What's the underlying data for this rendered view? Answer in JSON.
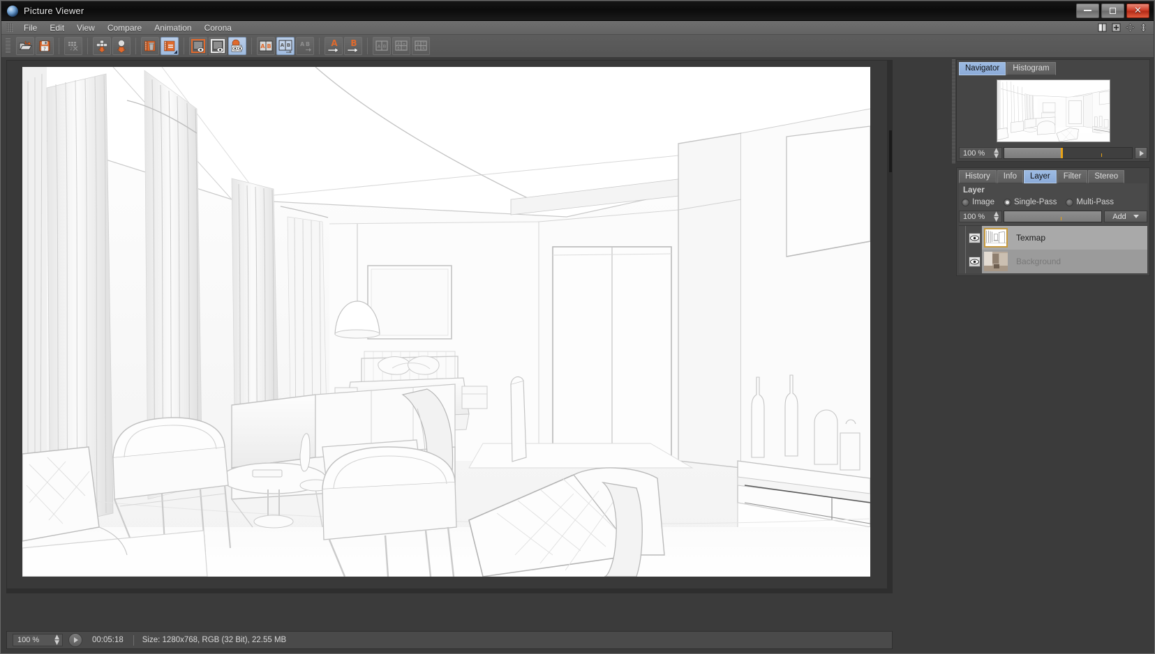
{
  "window": {
    "title": "Picture Viewer",
    "logo_icon": "cinema4d-sphere-icon",
    "minimize_label": "–",
    "maximize_label": "□",
    "close_label": "✕"
  },
  "menubar": {
    "grip_icon": "drag-grip-icon",
    "items": [
      {
        "label": "File"
      },
      {
        "label": "Edit"
      },
      {
        "label": "View"
      },
      {
        "label": "Compare"
      },
      {
        "label": "Animation"
      },
      {
        "label": "Corona"
      }
    ],
    "right_icons": [
      {
        "name": "split-layout-icon"
      },
      {
        "name": "add-panel-icon"
      },
      {
        "name": "move-panel-icon"
      },
      {
        "name": "resize-panel-icon"
      }
    ]
  },
  "toolbar": {
    "grip_icon": "drag-grip-icon",
    "groups": [
      {
        "buttons": [
          {
            "name": "open-file-button",
            "icon": "open-folder-icon",
            "active": false
          },
          {
            "name": "save-file-button",
            "icon": "save-disk-question-icon",
            "active": false
          }
        ]
      },
      {
        "buttons": [
          {
            "name": "filmstrip-button",
            "icon": "filmstrip-grid-icon",
            "active": false
          }
        ]
      },
      {
        "buttons": [
          {
            "name": "store-all-button",
            "icon": "store-all-frames-icon",
            "active": false
          },
          {
            "name": "store-frame-button",
            "icon": "store-single-frame-icon",
            "active": false
          }
        ]
      },
      {
        "buttons": [
          {
            "name": "delete-frame-button",
            "icon": "delete-frame-trash-icon",
            "active": false
          },
          {
            "name": "delete-all-button",
            "icon": "delete-all-frames-icon",
            "active": true
          }
        ]
      },
      {
        "buttons": [
          {
            "name": "view-a-button",
            "icon": "single-view-a-icon",
            "active": false
          },
          {
            "name": "view-b-button",
            "icon": "single-view-b-icon",
            "active": false
          },
          {
            "name": "view-ab-button",
            "icon": "blend-view-icon",
            "active": true
          }
        ]
      },
      {
        "buttons": [
          {
            "name": "compare-ab-button",
            "icon": "compare-ab-icon",
            "active": false
          },
          {
            "name": "compare-ab-swap-button",
            "icon": "compare-ab-swap-icon",
            "active": true
          },
          {
            "name": "compare-ab-diff-button",
            "icon": "compare-ab-diff-icon",
            "active": false
          }
        ]
      },
      {
        "buttons": [
          {
            "name": "set-a-button",
            "icon": "set-a-arrow-icon",
            "active": false
          },
          {
            "name": "set-b-button",
            "icon": "set-b-arrow-icon",
            "active": false
          }
        ]
      },
      {
        "buttons": [
          {
            "name": "ab-side-by-side-button",
            "icon": "ab-side-by-side-icon",
            "active": false
          },
          {
            "name": "ab-quad-button",
            "icon": "ab-quad-icon",
            "active": false
          },
          {
            "name": "ab-stack-button",
            "icon": "ab-stack-icon",
            "active": false
          }
        ]
      }
    ]
  },
  "navigator": {
    "tabs": [
      {
        "label": "Navigator",
        "active": true
      },
      {
        "label": "Histogram",
        "active": false
      }
    ],
    "zoom_value": "100 %",
    "play_icon": "play-triangle-icon",
    "spinner_icon": "up-down-spinner-icon"
  },
  "panel": {
    "tabs": [
      {
        "label": "History",
        "active": false
      },
      {
        "label": "Info",
        "active": false
      },
      {
        "label": "Layer",
        "active": true
      },
      {
        "label": "Filter",
        "active": false
      },
      {
        "label": "Stereo",
        "active": false
      }
    ],
    "section_title": "Layer",
    "modes": [
      {
        "label": "Image",
        "selected": false
      },
      {
        "label": "Single-Pass",
        "selected": true
      },
      {
        "label": "Multi-Pass",
        "selected": false
      }
    ],
    "opacity_value": "100 %",
    "add_label": "Add",
    "add_caret_icon": "chevron-down-icon",
    "layers": [
      {
        "name": "Texmap",
        "visible": true,
        "selected": true,
        "eye_icon": "eye-visible-icon"
      },
      {
        "name": "Background",
        "visible": true,
        "selected": false,
        "dimmed": true,
        "eye_icon": "eye-visible-icon"
      }
    ]
  },
  "statusbar": {
    "zoom_value": "100 %",
    "play_icon": "play-triangle-icon",
    "time": "00:05:18",
    "info": "Size: 1280x768, RGB (32 Bit), 22.55 MB"
  },
  "colors": {
    "accent_blue": "#9dbbe3",
    "accent_orange": "#e8a317",
    "panel_bg": "#454545",
    "toolbar_bg": "#5a5a5a",
    "titlebar_bg": "#101010",
    "close_red": "#cf3f2a",
    "layer_row_bg": "#9b9b9b",
    "thumb_selected_border": "#c79a3d"
  }
}
